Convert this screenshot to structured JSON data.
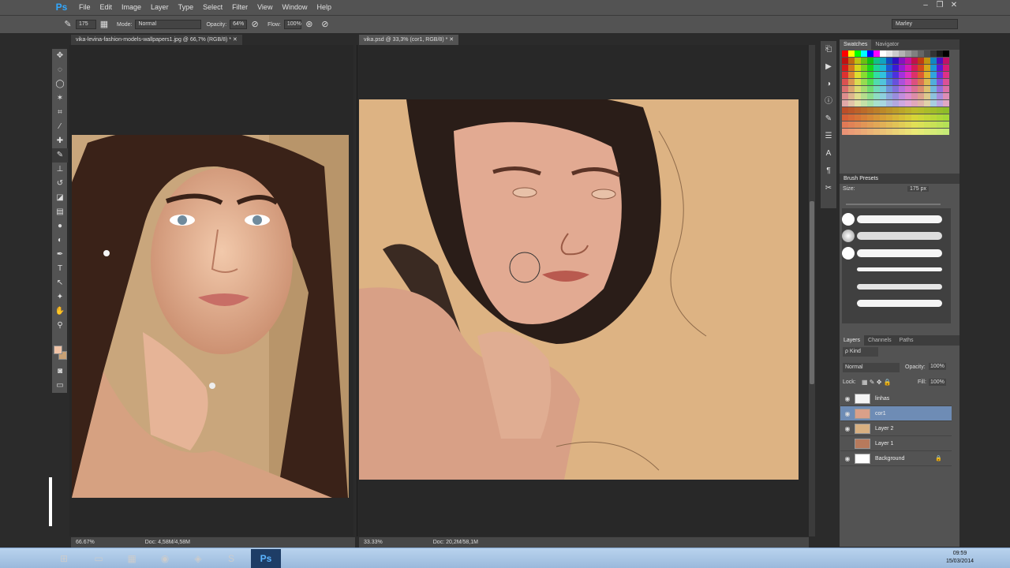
{
  "app": {
    "logo": "Ps"
  },
  "menu": [
    "File",
    "Edit",
    "Image",
    "Layer",
    "Type",
    "Select",
    "Filter",
    "View",
    "Window",
    "Help"
  ],
  "window_controls": {
    "minimize": "–",
    "restore": "❐",
    "close": "✕"
  },
  "options_bar": {
    "brush_size": "175",
    "mode_label": "Mode:",
    "mode_value": "Normal",
    "opacity_label": "Opacity:",
    "opacity_value": "64%",
    "flow_label": "Flow:",
    "flow_value": "100%"
  },
  "workspace": "Marley",
  "documents": [
    {
      "tab": "vika-levina-fashion-models-wallpapers1.jpg @ 66,7% (RGB/8) *",
      "zoom": "66.67%",
      "doc": "Doc: 4,58M/4,58M"
    },
    {
      "tab": "vika.psd @ 33,3% (cor1, RGB/8) *",
      "zoom": "33.33%",
      "doc": "Doc: 20,2M/58,1M"
    }
  ],
  "panels": {
    "swatches_tabs": [
      "Swatches",
      "Navigator"
    ],
    "brush_presets_title": "Brush Presets",
    "size_label": "Size:",
    "size_value": "175 px",
    "layers_tabs": [
      "Layers",
      "Channels",
      "Paths"
    ],
    "kind_label": "ρ Kind",
    "blend_mode": "Normal",
    "opacity_label": "Opacity:",
    "opacity_value": "100%",
    "lock_label": "Lock:",
    "fill_label": "Fill:",
    "fill_value": "100%"
  },
  "layers": [
    {
      "name": "linhas",
      "visible": true,
      "selected": false,
      "thumb": "#f4f4f4"
    },
    {
      "name": "cor1",
      "visible": true,
      "selected": true,
      "thumb": "#d9a089"
    },
    {
      "name": "Layer 2",
      "visible": true,
      "selected": false,
      "thumb": "#d8b081"
    },
    {
      "name": "Layer 1",
      "visible": false,
      "selected": false,
      "thumb": "#b77a5c"
    },
    {
      "name": "Background",
      "visible": true,
      "selected": false,
      "thumb": "#ffffff",
      "locked": true
    }
  ],
  "colors": {
    "foreground": "#f0c3a6",
    "background": "#c8a074",
    "selection": "#6e8cb5"
  },
  "taskbar": {
    "time": "09:59",
    "date": "15/03/2014"
  }
}
